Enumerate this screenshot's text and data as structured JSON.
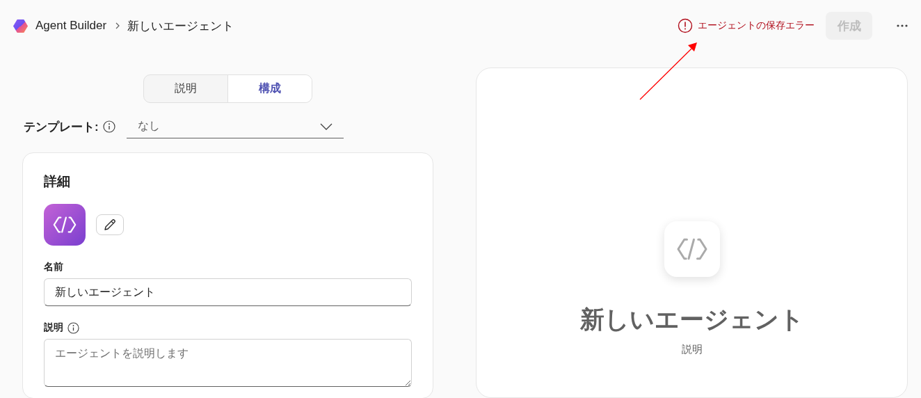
{
  "header": {
    "app_name": "Agent Builder",
    "page_title": "新しいエージェント",
    "error_message": "エージェントの保存エラー",
    "create_button": {
      "label": "作成",
      "disabled": true
    }
  },
  "tabs": [
    {
      "label": "説明",
      "selected": false
    },
    {
      "label": "構成",
      "selected": true
    }
  ],
  "template": {
    "label": "テンプレート:",
    "value": "なし"
  },
  "details": {
    "title": "詳細",
    "name_label": "名前",
    "name_value": "新しいエージェント",
    "description_label": "説明",
    "description_placeholder": "エージェントを説明します"
  },
  "preview": {
    "title": "新しいエージェント",
    "subtitle": "説明"
  }
}
